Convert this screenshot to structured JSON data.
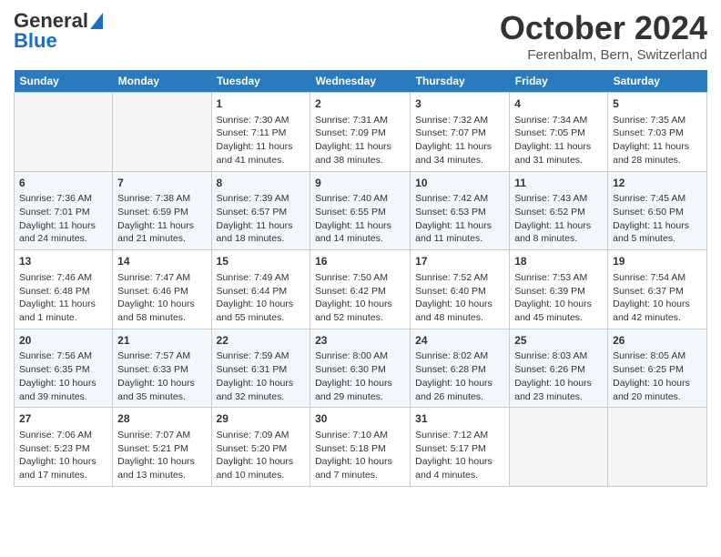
{
  "header": {
    "logo_line1": "General",
    "logo_line2": "Blue",
    "month": "October 2024",
    "location": "Ferenbalm, Bern, Switzerland"
  },
  "days_of_week": [
    "Sunday",
    "Monday",
    "Tuesday",
    "Wednesday",
    "Thursday",
    "Friday",
    "Saturday"
  ],
  "weeks": [
    [
      {
        "day": "",
        "sunrise": "",
        "sunset": "",
        "daylight": ""
      },
      {
        "day": "",
        "sunrise": "",
        "sunset": "",
        "daylight": ""
      },
      {
        "day": "1",
        "sunrise": "Sunrise: 7:30 AM",
        "sunset": "Sunset: 7:11 PM",
        "daylight": "Daylight: 11 hours and 41 minutes."
      },
      {
        "day": "2",
        "sunrise": "Sunrise: 7:31 AM",
        "sunset": "Sunset: 7:09 PM",
        "daylight": "Daylight: 11 hours and 38 minutes."
      },
      {
        "day": "3",
        "sunrise": "Sunrise: 7:32 AM",
        "sunset": "Sunset: 7:07 PM",
        "daylight": "Daylight: 11 hours and 34 minutes."
      },
      {
        "day": "4",
        "sunrise": "Sunrise: 7:34 AM",
        "sunset": "Sunset: 7:05 PM",
        "daylight": "Daylight: 11 hours and 31 minutes."
      },
      {
        "day": "5",
        "sunrise": "Sunrise: 7:35 AM",
        "sunset": "Sunset: 7:03 PM",
        "daylight": "Daylight: 11 hours and 28 minutes."
      }
    ],
    [
      {
        "day": "6",
        "sunrise": "Sunrise: 7:36 AM",
        "sunset": "Sunset: 7:01 PM",
        "daylight": "Daylight: 11 hours and 24 minutes."
      },
      {
        "day": "7",
        "sunrise": "Sunrise: 7:38 AM",
        "sunset": "Sunset: 6:59 PM",
        "daylight": "Daylight: 11 hours and 21 minutes."
      },
      {
        "day": "8",
        "sunrise": "Sunrise: 7:39 AM",
        "sunset": "Sunset: 6:57 PM",
        "daylight": "Daylight: 11 hours and 18 minutes."
      },
      {
        "day": "9",
        "sunrise": "Sunrise: 7:40 AM",
        "sunset": "Sunset: 6:55 PM",
        "daylight": "Daylight: 11 hours and 14 minutes."
      },
      {
        "day": "10",
        "sunrise": "Sunrise: 7:42 AM",
        "sunset": "Sunset: 6:53 PM",
        "daylight": "Daylight: 11 hours and 11 minutes."
      },
      {
        "day": "11",
        "sunrise": "Sunrise: 7:43 AM",
        "sunset": "Sunset: 6:52 PM",
        "daylight": "Daylight: 11 hours and 8 minutes."
      },
      {
        "day": "12",
        "sunrise": "Sunrise: 7:45 AM",
        "sunset": "Sunset: 6:50 PM",
        "daylight": "Daylight: 11 hours and 5 minutes."
      }
    ],
    [
      {
        "day": "13",
        "sunrise": "Sunrise: 7:46 AM",
        "sunset": "Sunset: 6:48 PM",
        "daylight": "Daylight: 11 hours and 1 minute."
      },
      {
        "day": "14",
        "sunrise": "Sunrise: 7:47 AM",
        "sunset": "Sunset: 6:46 PM",
        "daylight": "Daylight: 10 hours and 58 minutes."
      },
      {
        "day": "15",
        "sunrise": "Sunrise: 7:49 AM",
        "sunset": "Sunset: 6:44 PM",
        "daylight": "Daylight: 10 hours and 55 minutes."
      },
      {
        "day": "16",
        "sunrise": "Sunrise: 7:50 AM",
        "sunset": "Sunset: 6:42 PM",
        "daylight": "Daylight: 10 hours and 52 minutes."
      },
      {
        "day": "17",
        "sunrise": "Sunrise: 7:52 AM",
        "sunset": "Sunset: 6:40 PM",
        "daylight": "Daylight: 10 hours and 48 minutes."
      },
      {
        "day": "18",
        "sunrise": "Sunrise: 7:53 AM",
        "sunset": "Sunset: 6:39 PM",
        "daylight": "Daylight: 10 hours and 45 minutes."
      },
      {
        "day": "19",
        "sunrise": "Sunrise: 7:54 AM",
        "sunset": "Sunset: 6:37 PM",
        "daylight": "Daylight: 10 hours and 42 minutes."
      }
    ],
    [
      {
        "day": "20",
        "sunrise": "Sunrise: 7:56 AM",
        "sunset": "Sunset: 6:35 PM",
        "daylight": "Daylight: 10 hours and 39 minutes."
      },
      {
        "day": "21",
        "sunrise": "Sunrise: 7:57 AM",
        "sunset": "Sunset: 6:33 PM",
        "daylight": "Daylight: 10 hours and 35 minutes."
      },
      {
        "day": "22",
        "sunrise": "Sunrise: 7:59 AM",
        "sunset": "Sunset: 6:31 PM",
        "daylight": "Daylight: 10 hours and 32 minutes."
      },
      {
        "day": "23",
        "sunrise": "Sunrise: 8:00 AM",
        "sunset": "Sunset: 6:30 PM",
        "daylight": "Daylight: 10 hours and 29 minutes."
      },
      {
        "day": "24",
        "sunrise": "Sunrise: 8:02 AM",
        "sunset": "Sunset: 6:28 PM",
        "daylight": "Daylight: 10 hours and 26 minutes."
      },
      {
        "day": "25",
        "sunrise": "Sunrise: 8:03 AM",
        "sunset": "Sunset: 6:26 PM",
        "daylight": "Daylight: 10 hours and 23 minutes."
      },
      {
        "day": "26",
        "sunrise": "Sunrise: 8:05 AM",
        "sunset": "Sunset: 6:25 PM",
        "daylight": "Daylight: 10 hours and 20 minutes."
      }
    ],
    [
      {
        "day": "27",
        "sunrise": "Sunrise: 7:06 AM",
        "sunset": "Sunset: 5:23 PM",
        "daylight": "Daylight: 10 hours and 17 minutes."
      },
      {
        "day": "28",
        "sunrise": "Sunrise: 7:07 AM",
        "sunset": "Sunset: 5:21 PM",
        "daylight": "Daylight: 10 hours and 13 minutes."
      },
      {
        "day": "29",
        "sunrise": "Sunrise: 7:09 AM",
        "sunset": "Sunset: 5:20 PM",
        "daylight": "Daylight: 10 hours and 10 minutes."
      },
      {
        "day": "30",
        "sunrise": "Sunrise: 7:10 AM",
        "sunset": "Sunset: 5:18 PM",
        "daylight": "Daylight: 10 hours and 7 minutes."
      },
      {
        "day": "31",
        "sunrise": "Sunrise: 7:12 AM",
        "sunset": "Sunset: 5:17 PM",
        "daylight": "Daylight: 10 hours and 4 minutes."
      },
      {
        "day": "",
        "sunrise": "",
        "sunset": "",
        "daylight": ""
      },
      {
        "day": "",
        "sunrise": "",
        "sunset": "",
        "daylight": ""
      }
    ]
  ]
}
